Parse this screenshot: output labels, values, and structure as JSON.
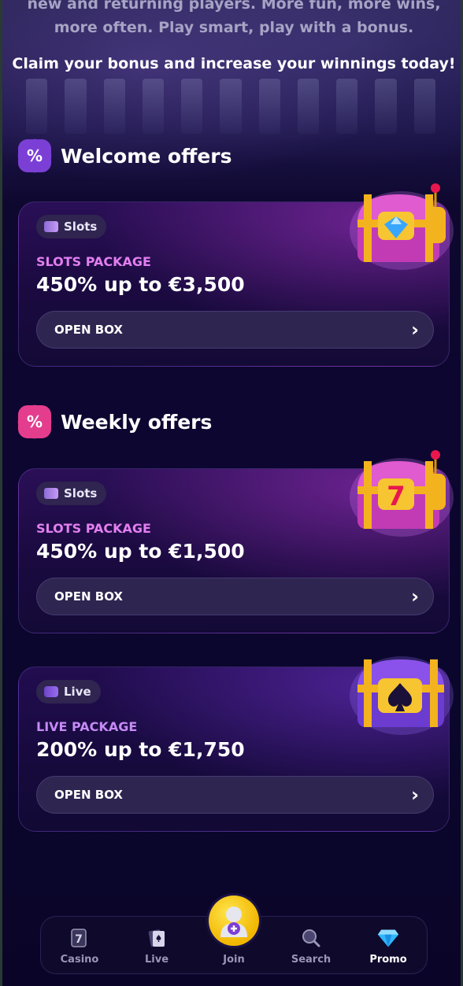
{
  "intro": {
    "line1": "new and returning players. More fun, more wins,",
    "line2": "more often. Play smart, play with a bonus.",
    "claim": "Claim your bonus and increase your winnings today!"
  },
  "sections": {
    "welcome": {
      "icon": "percent-badge-icon",
      "title": "Welcome offers"
    },
    "weekly": {
      "icon": "percent-badge-icon",
      "title": "Weekly offers"
    }
  },
  "offers": [
    {
      "tag": "Slots",
      "tag_icon": "slot-machine-icon",
      "package": "SLOTS PACKAGE",
      "amount": "450% up to €3,500",
      "button": "OPEN BOX",
      "chest_icon": "treasure-chest-diamond-icon"
    },
    {
      "tag": "Slots",
      "tag_icon": "slot-machine-icon",
      "package": "SLOTS PACKAGE",
      "amount": "450% up to €1,500",
      "button": "OPEN BOX",
      "chest_icon": "treasure-chest-seven-icon"
    },
    {
      "tag": "Live",
      "tag_icon": "live-cards-icon",
      "package": "LIVE PACKAGE",
      "amount": "200% up to €1,750",
      "button": "OPEN BOX",
      "chest_icon": "treasure-chest-spade-icon"
    }
  ],
  "nav": {
    "items": [
      {
        "label": "Casino",
        "icon": "seven-card-icon"
      },
      {
        "label": "Live",
        "icon": "playing-cards-icon"
      },
      {
        "label": "Join",
        "icon": "avatar-plus-icon"
      },
      {
        "label": "Search",
        "icon": "search-icon"
      },
      {
        "label": "Promo",
        "icon": "diamond-icon"
      }
    ],
    "active": "Promo"
  },
  "colors": {
    "package_pink": "#e27ff0",
    "package_purple": "#c58af5",
    "join_yellow": "#f1b600",
    "badge_purple": "#7b3fd6",
    "badge_pink": "#e53d8e"
  }
}
